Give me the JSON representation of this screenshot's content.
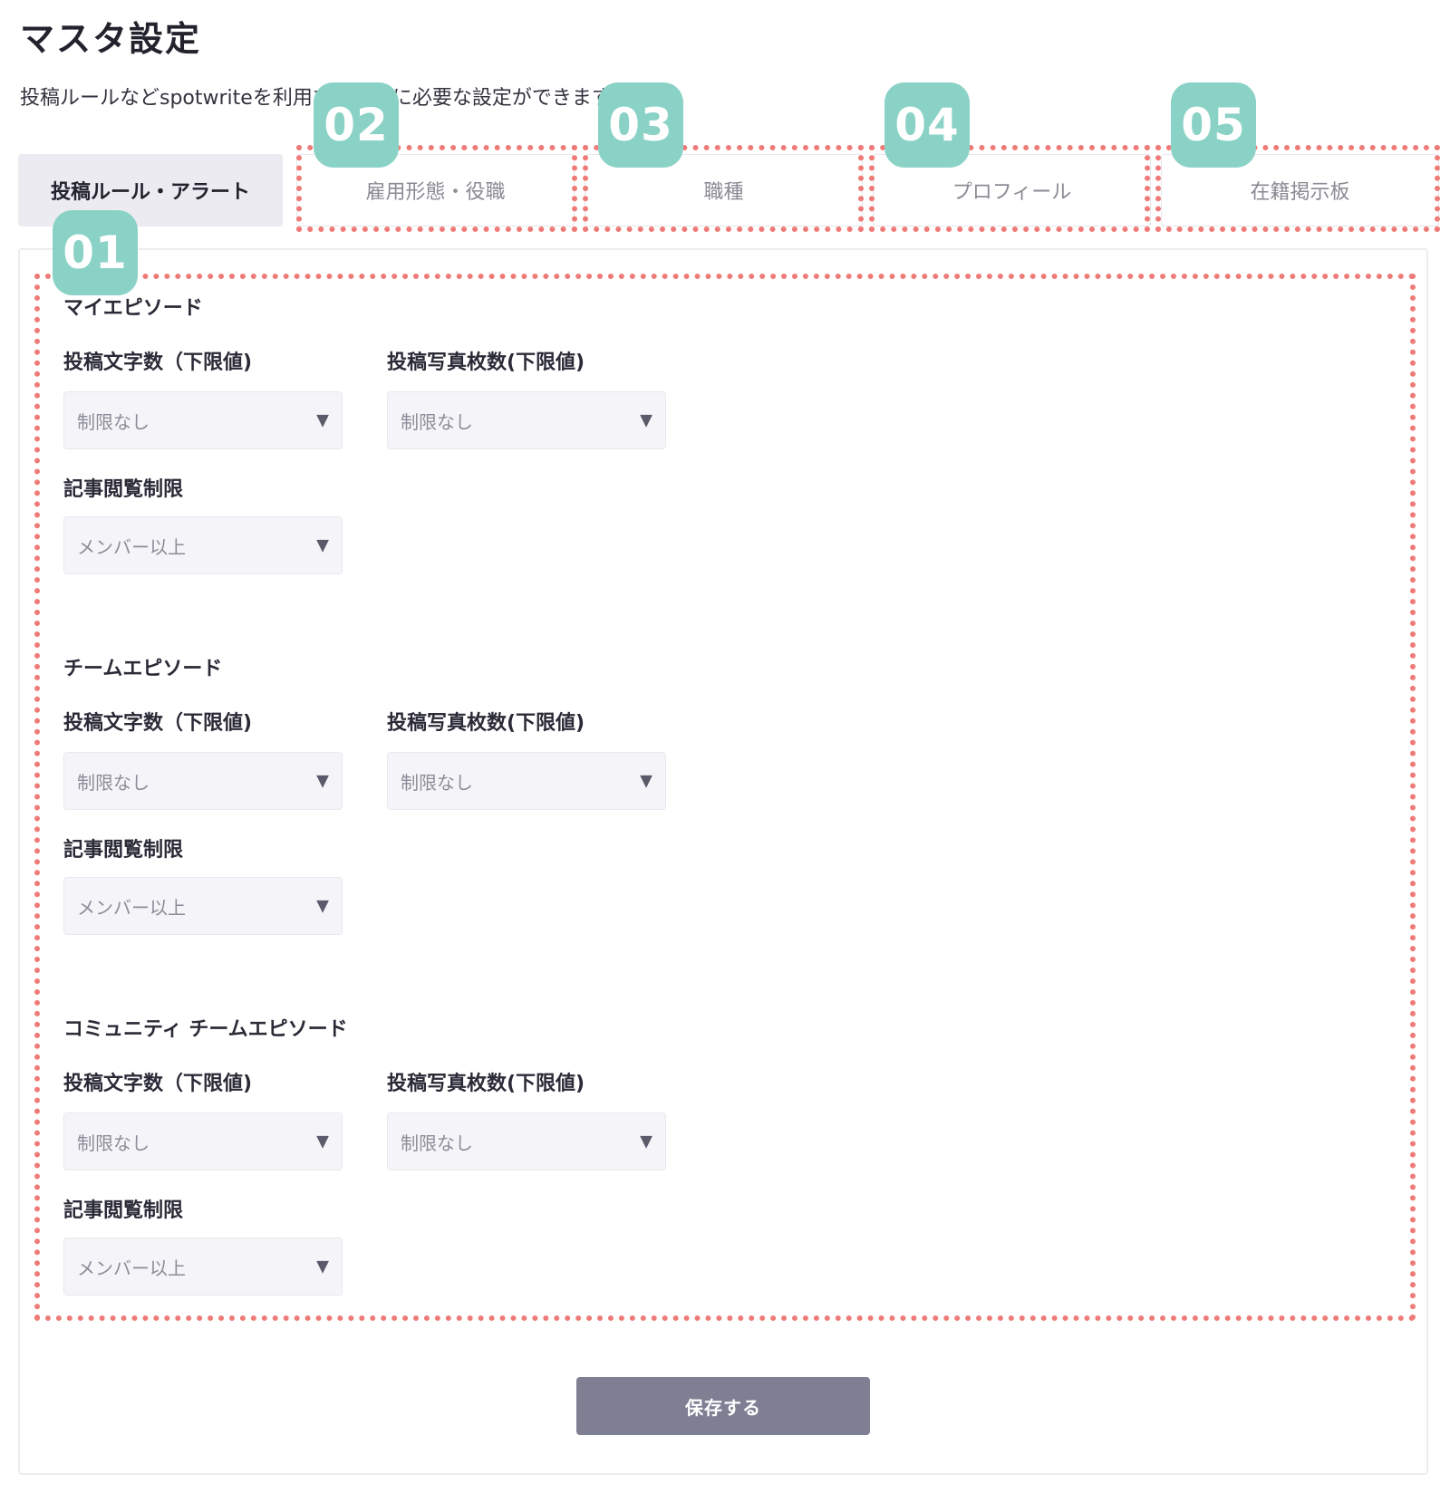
{
  "header": {
    "title": "マスタ設定",
    "description": "投稿ルールなどspotwriteを利用するさいに必要な設定ができます。"
  },
  "tabs": [
    {
      "label": "投稿ルール・アラート",
      "active": true
    },
    {
      "label": "雇用形態・役職",
      "active": false
    },
    {
      "label": "職種",
      "active": false
    },
    {
      "label": "プロフィール",
      "active": false
    },
    {
      "label": "在籍掲示板",
      "active": false
    }
  ],
  "sections": [
    {
      "title": "マイエピソード",
      "char_label": "投稿文字数（下限値)",
      "char_value": "制限なし",
      "photo_label": "投稿写真枚数(下限値)",
      "photo_value": "制限なし",
      "view_label": "記事閲覧制限",
      "view_value": "メンバー以上"
    },
    {
      "title": "チームエピソード",
      "char_label": "投稿文字数（下限値)",
      "char_value": "制限なし",
      "photo_label": "投稿写真枚数(下限値)",
      "photo_value": "制限なし",
      "view_label": "記事閲覧制限",
      "view_value": "メンバー以上"
    },
    {
      "title": "コミュニティ チームエピソード",
      "char_label": "投稿文字数（下限値)",
      "char_value": "制限なし",
      "photo_label": "投稿写真枚数(下限値)",
      "photo_value": "制限なし",
      "view_label": "記事閲覧制限",
      "view_value": "メンバー以上"
    }
  ],
  "dropdown_icon": "triangle-down-icon",
  "save_label": "保存する",
  "annotations": [
    "01",
    "02",
    "03",
    "04",
    "05"
  ],
  "colors": {
    "annotation_border": "#ef7b78",
    "annotation_badge": "#8ad2c6",
    "save_button": "#7e7f93",
    "active_tab": "#ebebf1"
  }
}
